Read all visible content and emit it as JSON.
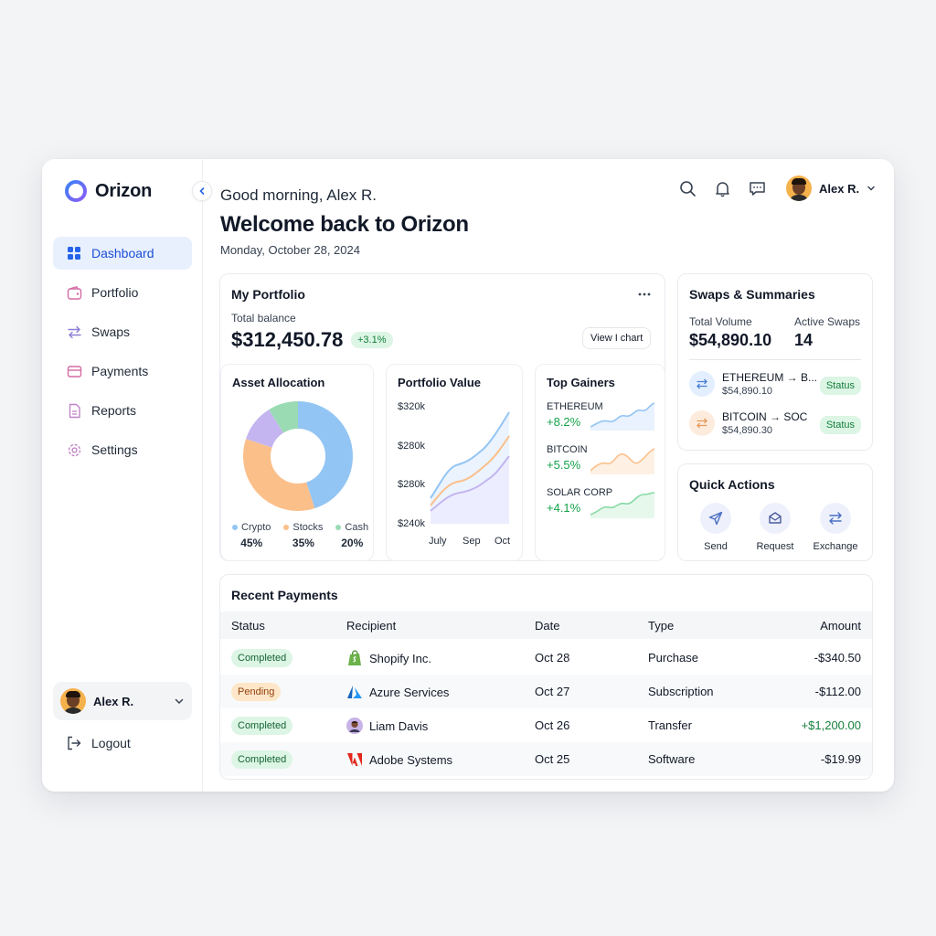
{
  "app": {
    "name": "Orizon"
  },
  "sidebar": {
    "items": [
      {
        "label": "Dashboard",
        "icon": "grid-icon",
        "active": true
      },
      {
        "label": "Portfolio",
        "icon": "wallet-icon"
      },
      {
        "label": "Swaps",
        "icon": "swap-icon"
      },
      {
        "label": "Payments",
        "icon": "card-icon"
      },
      {
        "label": "Reports",
        "icon": "document-icon"
      },
      {
        "label": "Settings",
        "icon": "gear-icon"
      }
    ],
    "user": {
      "name": "Alex R."
    },
    "logout_label": "Logout"
  },
  "header": {
    "greeting": "Good morning, Alex R.",
    "welcome": "Welcome back to Orizon",
    "date": "Monday, October 28, 2024",
    "user_name": "Alex R."
  },
  "portfolio": {
    "title": "My Portfolio",
    "total_label": "Total balance",
    "total_value": "$312,450.78",
    "change": "+3.1%",
    "view_chart_label": "View I chart",
    "allocation": {
      "title": "Asset Allocation",
      "items": [
        {
          "label": "Crypto",
          "pct": "45%",
          "value": 45,
          "color": "#93c5f4"
        },
        {
          "label": "Stocks",
          "pct": "35%",
          "value": 35,
          "color": "#fbbf8a"
        },
        {
          "label": "Cash",
          "pct": "20%",
          "value": 20,
          "color": "#9adbb4"
        }
      ],
      "extra_slice_color": "#c4b5f0"
    },
    "value_chart": {
      "title": "Portfolio Value",
      "y_ticks": [
        "$320k",
        "$280k",
        "$280k",
        "$240k"
      ],
      "x_ticks": [
        "July",
        "Sep",
        "Oct"
      ]
    },
    "gainers": {
      "title": "Top Gainers",
      "items": [
        {
          "name": "ETHEREUM",
          "change": "+8.2%",
          "color": "#93c5f4"
        },
        {
          "name": "BITCOIN",
          "change": "+5.5%",
          "color": "#fbbf8a"
        },
        {
          "name": "SOLAR CORP",
          "change": "+4.1%",
          "color": "#86d9a5"
        }
      ]
    }
  },
  "swaps": {
    "title": "Swaps & Summaries",
    "total_volume_label": "Total Volume",
    "total_volume": "$54,890.10",
    "active_label": "Active Swaps",
    "active_count": "14",
    "rows": [
      {
        "pair": "ETHEREUM → B...",
        "amount": "$54,890.10",
        "status": "Status",
        "color": "#e3efff",
        "icon_color": "#4a7fd0"
      },
      {
        "pair": "BITCOIN → SOC",
        "amount": "$54,890.30",
        "status": "Status",
        "color": "#fdecdd",
        "icon_color": "#e39a5b"
      }
    ]
  },
  "quick_actions": {
    "title": "Quick Actions",
    "items": [
      {
        "label": "Send",
        "icon": "send-icon"
      },
      {
        "label": "Request",
        "icon": "request-icon"
      },
      {
        "label": "Exchange",
        "icon": "exchange-icon"
      }
    ]
  },
  "payments": {
    "title": "Recent Payments",
    "columns": [
      "Status",
      "Recipient",
      "Date",
      "Type",
      "Amount"
    ],
    "rows": [
      {
        "status": "Completed",
        "status_kind": "completed",
        "recipient": "Shopify Inc.",
        "logo": "shopify-icon",
        "date": "Oct 28",
        "type": "Purchase",
        "amount": "-$340.50",
        "amount_color": "#111827"
      },
      {
        "status": "Pending",
        "status_kind": "pending",
        "recipient": "Azure Services",
        "logo": "azure-icon",
        "date": "Oct 27",
        "type": "Subscription",
        "amount": "-$112.00",
        "amount_color": "#111827"
      },
      {
        "status": "Completed",
        "status_kind": "completed",
        "recipient": "Liam Davis",
        "logo": "person-avatar-icon",
        "date": "Oct 26",
        "type": "Transfer",
        "amount": "+$1,200.00",
        "amount_color": "#15803d"
      },
      {
        "status": "Completed",
        "status_kind": "completed",
        "recipient": "Adobe Systems",
        "logo": "adobe-icon",
        "date": "Oct 25",
        "type": "Software",
        "amount": "-$19.99",
        "amount_color": "#111827"
      }
    ]
  }
}
